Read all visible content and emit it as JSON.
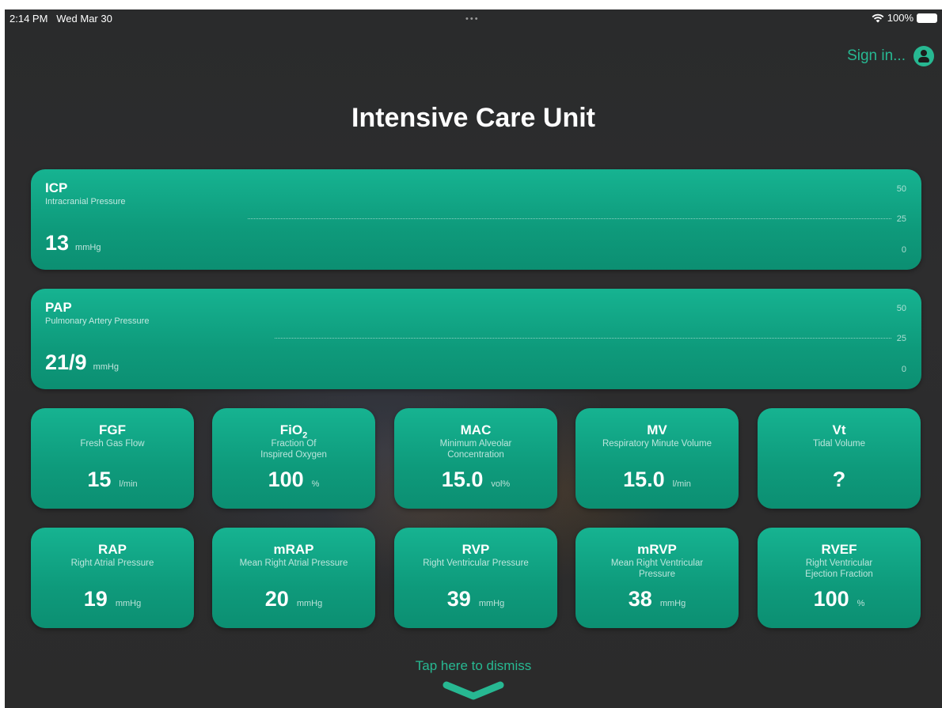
{
  "status_bar": {
    "time": "2:14 PM",
    "date": "Wed Mar 30",
    "battery": "100%",
    "dots": "•••"
  },
  "header": {
    "sign_in": "Sign in...",
    "title": "Intensive Care Unit"
  },
  "wide_cards": [
    {
      "abbr": "ICP",
      "full": "Intracranial Pressure",
      "value": "13",
      "unit": "mmHg",
      "scale_max": "50",
      "scale_mid": "25",
      "scale_min": "0"
    },
    {
      "abbr": "PAP",
      "full": "Pulmonary Artery Pressure",
      "value": "21/9",
      "unit": "mmHg",
      "scale_max": "50",
      "scale_mid": "25",
      "scale_min": "0"
    }
  ],
  "tiles": [
    {
      "abbr": "FGF",
      "full": "Fresh Gas Flow",
      "value": "15",
      "unit": "l/min"
    },
    {
      "abbr": "FiO",
      "abbr_sub": "2",
      "full": "Fraction Of Inspired Oxygen",
      "value": "100",
      "unit": "%"
    },
    {
      "abbr": "MAC",
      "full": "Minimum Alveolar Concentration",
      "value": "15.0",
      "unit": "vol%"
    },
    {
      "abbr": "MV",
      "full": "Respiratory Minute Volume",
      "value": "15.0",
      "unit": "l/min"
    },
    {
      "abbr": "Vt",
      "full": "Tidal Volume",
      "value": "?",
      "unit": ""
    },
    {
      "abbr": "RAP",
      "full": "Right Atrial Pressure",
      "value": "19",
      "unit": "mmHg"
    },
    {
      "abbr": "mRAP",
      "full": "Mean Right Atrial Pressure",
      "value": "20",
      "unit": "mmHg"
    },
    {
      "abbr": "RVP",
      "full": "Right Ventricular Pressure",
      "value": "39",
      "unit": "mmHg"
    },
    {
      "abbr": "mRVP",
      "full": "Mean Right Ventricular Pressure",
      "value": "38",
      "unit": "mmHg"
    },
    {
      "abbr": "RVEF",
      "full": "Right Ventricular Ejection Fraction",
      "value": "100",
      "unit": "%"
    }
  ],
  "footer": {
    "dismiss": "Tap here to dismiss",
    "chevron_icon": "chevron-down-icon"
  },
  "colors": {
    "accent": "#27b892",
    "card": "#12a584",
    "background": "#2b2b2b"
  }
}
